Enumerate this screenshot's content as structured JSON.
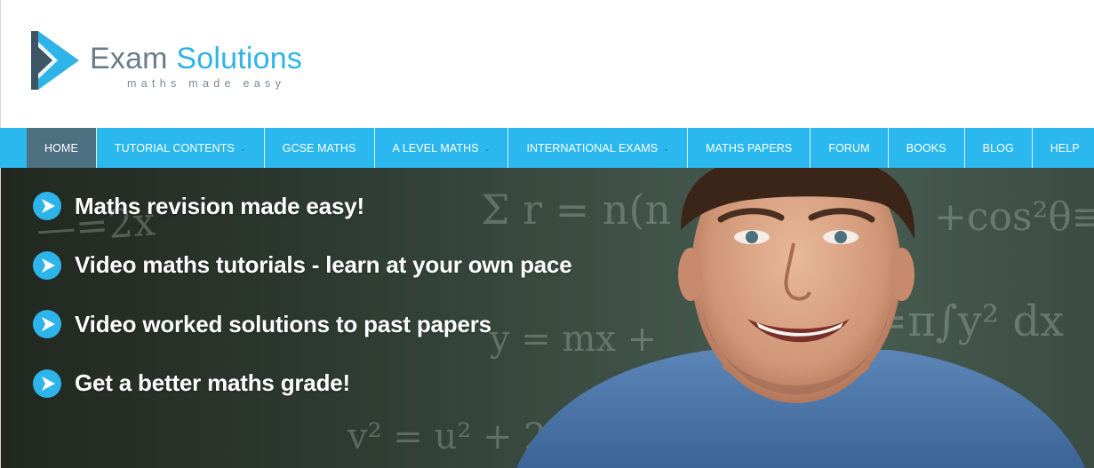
{
  "logo": {
    "word1": "Exam",
    "word2": "Solutions",
    "tagline": "maths made easy"
  },
  "nav": {
    "items": [
      {
        "label": "HOME",
        "active": true,
        "dropdown": false
      },
      {
        "label": "TUTORIAL CONTENTS",
        "active": false,
        "dropdown": true
      },
      {
        "label": "GCSE MATHS",
        "active": false,
        "dropdown": false
      },
      {
        "label": "A LEVEL MATHS",
        "active": false,
        "dropdown": true
      },
      {
        "label": "INTERNATIONAL EXAMS",
        "active": false,
        "dropdown": true
      },
      {
        "label": "MATHS PAPERS",
        "active": false,
        "dropdown": false
      },
      {
        "label": "FORUM",
        "active": false,
        "dropdown": false
      },
      {
        "label": "BOOKS",
        "active": false,
        "dropdown": false
      },
      {
        "label": "BLOG",
        "active": false,
        "dropdown": false
      },
      {
        "label": "HELP",
        "active": false,
        "dropdown": false
      }
    ]
  },
  "hero": {
    "bullets": [
      "Maths revision made easy!",
      "Video maths tutorials - learn at your own pace",
      "Video worked solutions to past papers",
      "Get a better maths grade!"
    ]
  },
  "colors": {
    "accent": "#2bb8ef",
    "nav_active": "#4e7182",
    "logo_grey": "#6a7b8a",
    "bullet_icon": "#2db4ea"
  }
}
